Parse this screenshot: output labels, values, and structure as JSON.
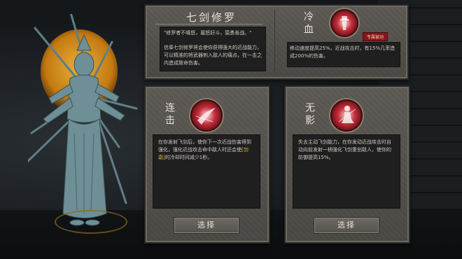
{
  "main_skill": {
    "name": "七剑修罗",
    "quote": "\"修罗者不嗔怒，嚣怒好斗，猿勇善战。\"",
    "desc": "信奉七剑修罗将会使你获得强大的近战能力，可以精准的将武器刺入敌人的痛点，在一击之内造成致命伤害。"
  },
  "passive": {
    "name": "冷血",
    "badge": "专属被动",
    "desc": "移动速度提高25%，近战攻击时，有15%几率造成200%的伤害。"
  },
  "choices": [
    {
      "name": "连击",
      "desc_pre": "在你发射飞剑后，使你下一次近战伤害得到强化，强化近战攻击命中敌人时还会使",
      "desc_hl": "[剑·霜]",
      "desc_post": "的冷却时间减少1秒。",
      "button": "选择"
    },
    {
      "name": "无影",
      "desc": "失去主动飞剑能力，在你发动近战攻击时自动向前发射一柄强化飞剑重创敌人，使你的防御提高15%。",
      "button": "选择"
    }
  ],
  "colors": {
    "accent_gold": "#d9b04a",
    "blood_red": "#c8303c",
    "panel_stone": "#55524d"
  }
}
